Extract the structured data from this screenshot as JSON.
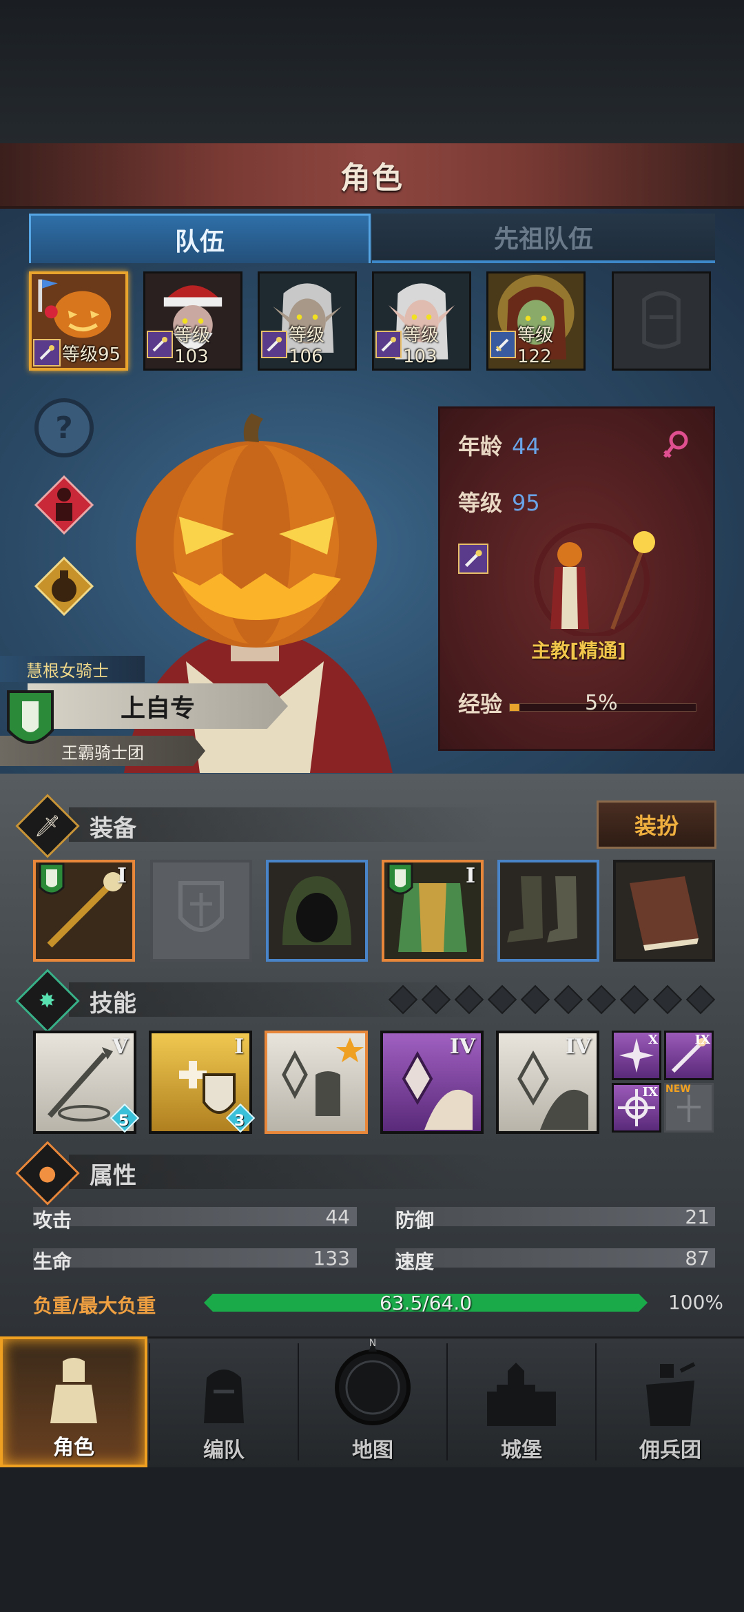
{
  "header": {
    "title": "角色"
  },
  "tabs": [
    {
      "label": "队伍",
      "active": true
    },
    {
      "label": "先祖队伍",
      "active": false
    }
  ],
  "party": [
    {
      "level_text": "等级95",
      "selected": true
    },
    {
      "level_text": "等级103",
      "selected": false
    },
    {
      "level_text": "等级106",
      "selected": false
    },
    {
      "level_text": "等级103",
      "selected": false
    },
    {
      "level_text": "等级122",
      "selected": false
    }
  ],
  "character": {
    "title": "慧根女骑士",
    "name": "上自专",
    "guild": "王霸骑士团",
    "age_label": "年龄",
    "age": "44",
    "level_label": "等级",
    "level": "95",
    "job": "主教[精通]",
    "exp_label": "经验",
    "exp_pct": "5%",
    "exp_fraction": 0.05,
    "gender": "female"
  },
  "equipment": {
    "title": "装备",
    "dress_button": "装扮",
    "slots": [
      {
        "tier": "I",
        "rarity": "orange"
      },
      {
        "tier": "",
        "rarity": "empty"
      },
      {
        "tier": "",
        "rarity": "blue"
      },
      {
        "tier": "I",
        "rarity": "orange"
      },
      {
        "tier": "",
        "rarity": "blue"
      },
      {
        "tier": "",
        "rarity": "none"
      }
    ]
  },
  "skills": {
    "title": "技能",
    "slots": [
      {
        "tier": "V",
        "gem": "5"
      },
      {
        "tier": "I",
        "gem": "3"
      },
      {
        "tier": "",
        "gem": ""
      },
      {
        "tier": "IV",
        "gem": ""
      },
      {
        "tier": "IV",
        "gem": ""
      }
    ],
    "mini": [
      {
        "tier": "X"
      },
      {
        "tier": "IX"
      },
      {
        "tier": "IX"
      }
    ],
    "new_label": "NEW"
  },
  "attributes": {
    "title": "属性",
    "attack_label": "攻击",
    "attack": "44",
    "defense_label": "防御",
    "defense": "21",
    "hp_label": "生命",
    "hp": "133",
    "speed_label": "速度",
    "speed": "87",
    "load_label": "负重/最大负重",
    "load_value": "63.5/64.0",
    "load_pct": "100%"
  },
  "nav": [
    {
      "label": "角色",
      "active": true
    },
    {
      "label": "编队",
      "active": false
    },
    {
      "label": "地图",
      "active": false
    },
    {
      "label": "城堡",
      "active": false
    },
    {
      "label": "佣兵团",
      "active": false
    }
  ],
  "colors": {
    "accent": "#e8a42c",
    "tab_blue": "#3d88c8",
    "load_green": "#1aaa4a",
    "level_blue": "#6aa4e8",
    "job_gold": "#f2c64a"
  }
}
